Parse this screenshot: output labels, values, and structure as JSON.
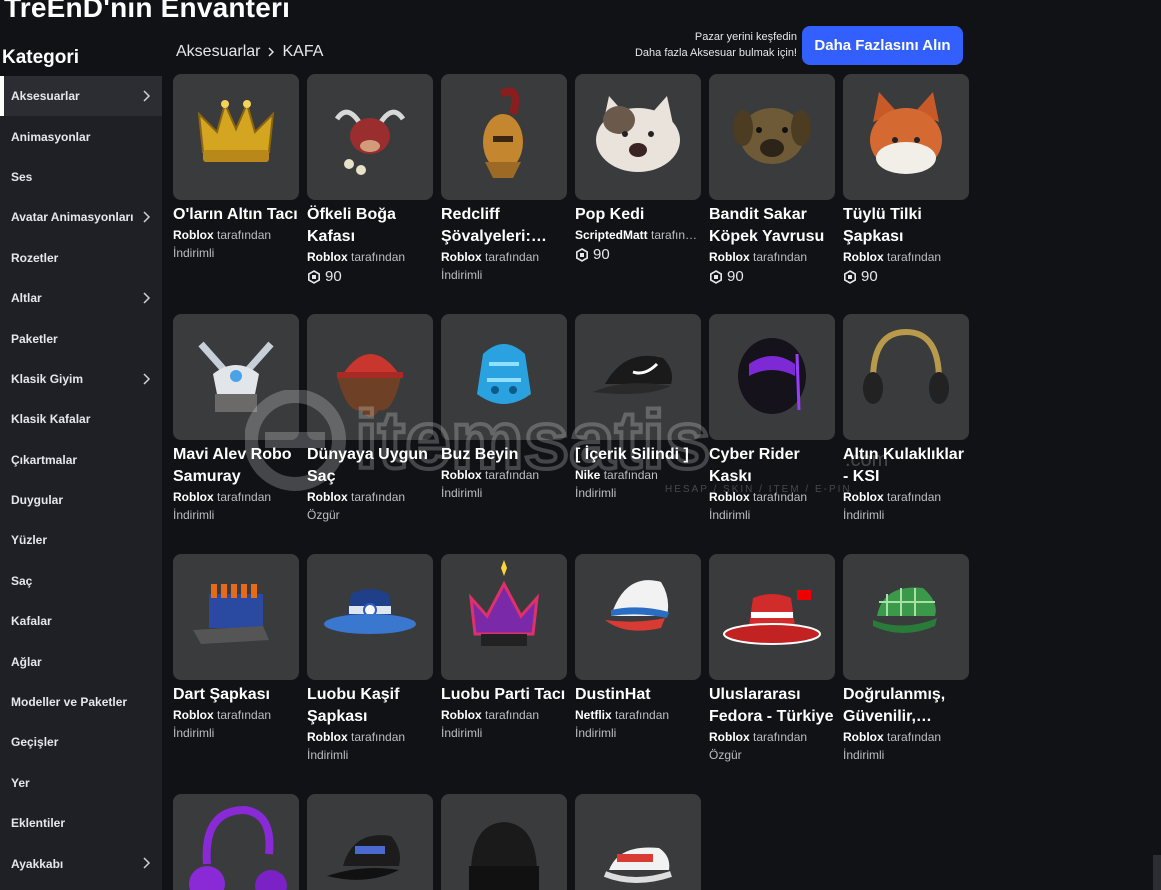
{
  "page": {
    "title": "TreEnD'nin Envanteri"
  },
  "sidebar": {
    "heading": "Kategori",
    "items": [
      {
        "label": "Aksesuarlar",
        "chevron": true,
        "active": true
      },
      {
        "label": "Animasyonlar",
        "chevron": false
      },
      {
        "label": "Ses",
        "chevron": false
      },
      {
        "label": "Avatar Animasyonları",
        "chevron": true
      },
      {
        "label": "Rozetler",
        "chevron": false
      },
      {
        "label": "Altlar",
        "chevron": true
      },
      {
        "label": "Paketler",
        "chevron": false
      },
      {
        "label": "Klasik Giyim",
        "chevron": true
      },
      {
        "label": "Klasik Kafalar",
        "chevron": false
      },
      {
        "label": "Çıkartmalar",
        "chevron": false
      },
      {
        "label": "Duygular",
        "chevron": false
      },
      {
        "label": "Yüzler",
        "chevron": false
      },
      {
        "label": "Saç",
        "chevron": false
      },
      {
        "label": "Kafalar",
        "chevron": false
      },
      {
        "label": "Ağlar",
        "chevron": false
      },
      {
        "label": "Modeller ve Paketler",
        "chevron": false
      },
      {
        "label": "Geçişler",
        "chevron": false
      },
      {
        "label": "Yer",
        "chevron": false
      },
      {
        "label": "Eklentiler",
        "chevron": false
      },
      {
        "label": "Ayakkabı",
        "chevron": true
      }
    ]
  },
  "breadcrumb": {
    "parent": "Aksesuarlar",
    "current": "KAFA"
  },
  "promo": {
    "line1": "Pazar yerini keşfedin",
    "line2": "Daha fazla Aksesuar bulmak için!",
    "button": "Daha Fazlasını Alın"
  },
  "colors": {
    "accent": "#335fff",
    "sidebar_bg": "#1e2026",
    "page_bg": "#111216",
    "card_bg": "#393b3d"
  },
  "watermark": {
    "text": "itemsatis",
    "sub": "HESAP / SKIN / ITEM / E-PIN",
    "com": ".com"
  },
  "items": [
    {
      "name": "O'ların Altın Tacı",
      "creator": "Roblox",
      "by": "tarafından",
      "status": "İndirimli",
      "icon": "gold-crown"
    },
    {
      "name": "Öfkeli Boğa Kafası",
      "creator": "Roblox",
      "by": "tarafından",
      "price": "90",
      "icon": "bull-head"
    },
    {
      "name": "Redcliff Şövalyeleri:…",
      "creator": "Roblox",
      "by": "tarafından",
      "status": "İndirimli",
      "icon": "knight-helm"
    },
    {
      "name": "Pop Kedi",
      "creator": "ScriptedMatt",
      "by": "tarafın…",
      "price": "90",
      "icon": "pop-cat"
    },
    {
      "name": "Bandit Sakar Köpek Yavrusu",
      "creator": "Roblox",
      "by": "tarafından",
      "price": "90",
      "icon": "puppy-head"
    },
    {
      "name": "Tüylü Tilki Şapkası",
      "creator": "Roblox",
      "by": "tarafından",
      "price": "90",
      "icon": "fox-hat"
    },
    {
      "name": "Mavi Alev Robo Samuray",
      "creator": "Roblox",
      "by": "tarafından",
      "status": "İndirimli",
      "icon": "samurai-helm"
    },
    {
      "name": "Dünyaya Uygun Saç",
      "creator": "Roblox",
      "by": "tarafından",
      "status": "Özgür",
      "icon": "hair-cap"
    },
    {
      "name": "Buz Beyin",
      "creator": "Roblox",
      "by": "tarafından",
      "status": "İndirimli",
      "icon": "ice-brain"
    },
    {
      "name": "[ İçerik Silindi ]",
      "creator": "Nike",
      "by": "tarafından",
      "status": "İndirimli",
      "icon": "nike-cap"
    },
    {
      "name": "Cyber Rider Kaskı",
      "creator": "Roblox",
      "by": "tarafından",
      "status": "İndirimli",
      "icon": "cyber-helmet"
    },
    {
      "name": "Altın Kulaklıklar - KSI",
      "creator": "Roblox",
      "by": "tarafından",
      "status": "İndirimli",
      "icon": "gold-headphones"
    },
    {
      "name": "Dart Şapkası",
      "creator": "Roblox",
      "by": "tarafından",
      "status": "İndirimli",
      "icon": "dart-hat"
    },
    {
      "name": "Luobu Kaşif Şapkası",
      "creator": "Roblox",
      "by": "tarafından",
      "status": "İndirimli",
      "icon": "explorer-hat"
    },
    {
      "name": "Luobu Parti Tacı",
      "creator": "Roblox",
      "by": "tarafından",
      "status": "İndirimli",
      "icon": "party-crown"
    },
    {
      "name": "DustinHat",
      "creator": "Netflix",
      "by": "tarafından",
      "status": "İndirimli",
      "icon": "trucker-cap"
    },
    {
      "name": "Uluslararası Fedora - Türkiye",
      "creator": "Roblox",
      "by": "tarafından",
      "status": "Özgür",
      "icon": "turkey-fedora"
    },
    {
      "name": "Doğrulanmış, Güvenilir,…",
      "creator": "Roblox",
      "by": "tarafından",
      "status": "İndirimli",
      "icon": "plaid-cap"
    },
    {
      "name": "",
      "icon": "purple-headphones"
    },
    {
      "name": "",
      "icon": "black-cap"
    },
    {
      "name": "",
      "icon": "royal-beanie"
    },
    {
      "name": "",
      "icon": "roblox-cap"
    }
  ]
}
